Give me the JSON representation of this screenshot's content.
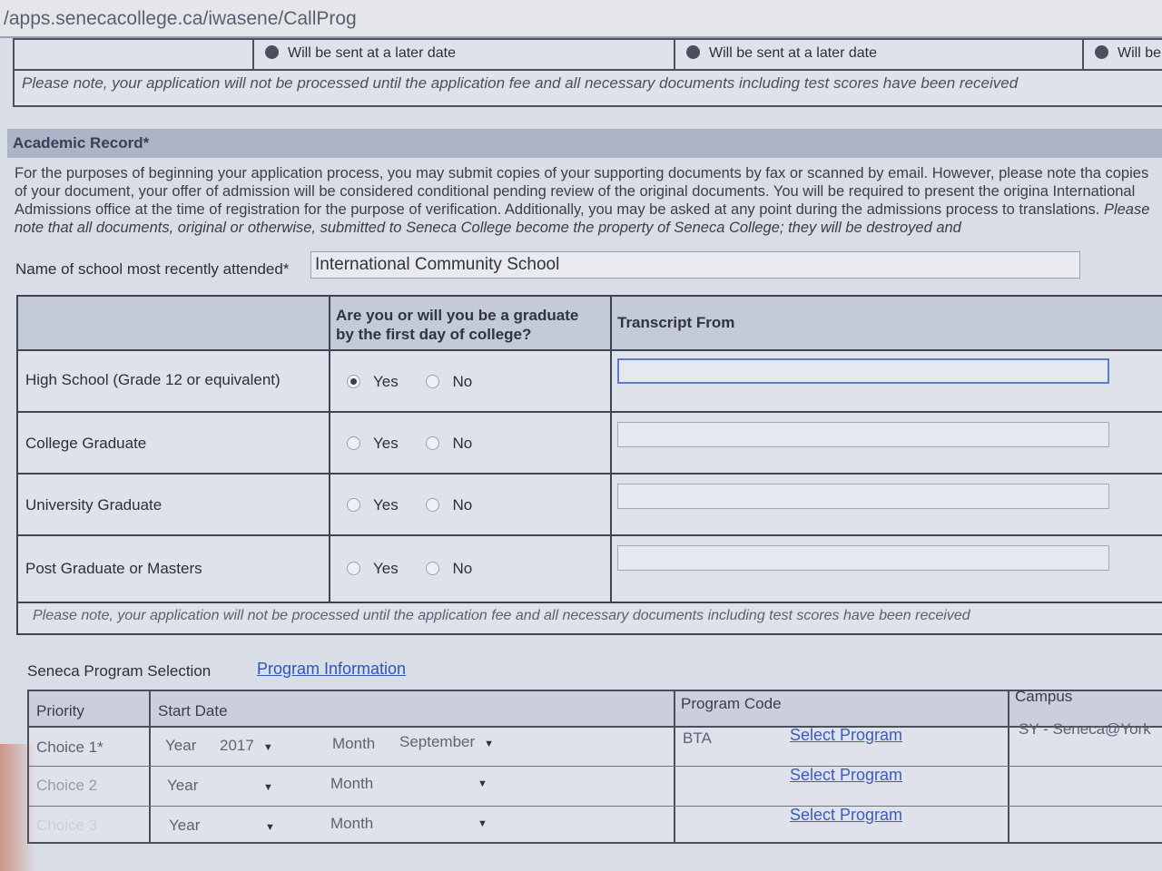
{
  "browser": {
    "url": "/apps.senecacollege.ca/iwasene/CallProg"
  },
  "top_section": {
    "options": [
      "Will be sent at a later date",
      "Will be sent at a later date",
      "Will be"
    ],
    "note": "Please note, your application will not be processed until the application fee and all necessary documents including test scores have been received"
  },
  "academic_record": {
    "title": "Academic Record*",
    "paragraph_normal": "For the purposes of beginning your application process, you may submit copies of your supporting documents by fax or scanned by email. However, please note tha copies of your document, your offer of admission will be considered conditional pending review of the original documents. You will be required to present the origina International Admissions office at the time of registration for the purpose of verification. Additionally, you may be asked at any point during the admissions process to translations.",
    "paragraph_italic": "Please note that all documents, original or otherwise, submitted to Seneca College become the property of Seneca College; they will be destroyed and",
    "school_label": "Name of school most recently attended*",
    "school_value": "International Community School",
    "table": {
      "col_graduate": "Are you or will you be a graduate by the first day of college?",
      "col_transcript": "Transcript From",
      "yes_label": "Yes",
      "no_label": "No",
      "rows": [
        {
          "label": "High School (Grade 12 or equivalent)",
          "selected": "Yes"
        },
        {
          "label": "College Graduate",
          "selected": ""
        },
        {
          "label": "University Graduate",
          "selected": ""
        },
        {
          "label": "Post Graduate or Masters",
          "selected": ""
        }
      ],
      "note": "Please note, your application will not be processed until the application fee and all necessary documents including test scores have been received"
    }
  },
  "program_selection": {
    "label": "Seneca Program Selection",
    "info_link": "Program Information",
    "headers": {
      "priority": "Priority",
      "start_date": "Start Date",
      "program_code": "Program Code",
      "campus": "Campus"
    },
    "year_label": "Year",
    "month_label": "Month",
    "select_link": "Select Program",
    "rows": [
      {
        "priority": "Choice 1*",
        "year": "2017",
        "month": "September",
        "code": "BTA",
        "campus": "SY - Seneca@York"
      },
      {
        "priority": "Choice 2",
        "year": "",
        "month": "",
        "code": "",
        "campus": ""
      },
      {
        "priority": "Choice 3",
        "year": "",
        "month": "",
        "code": "",
        "campus": ""
      }
    ]
  }
}
